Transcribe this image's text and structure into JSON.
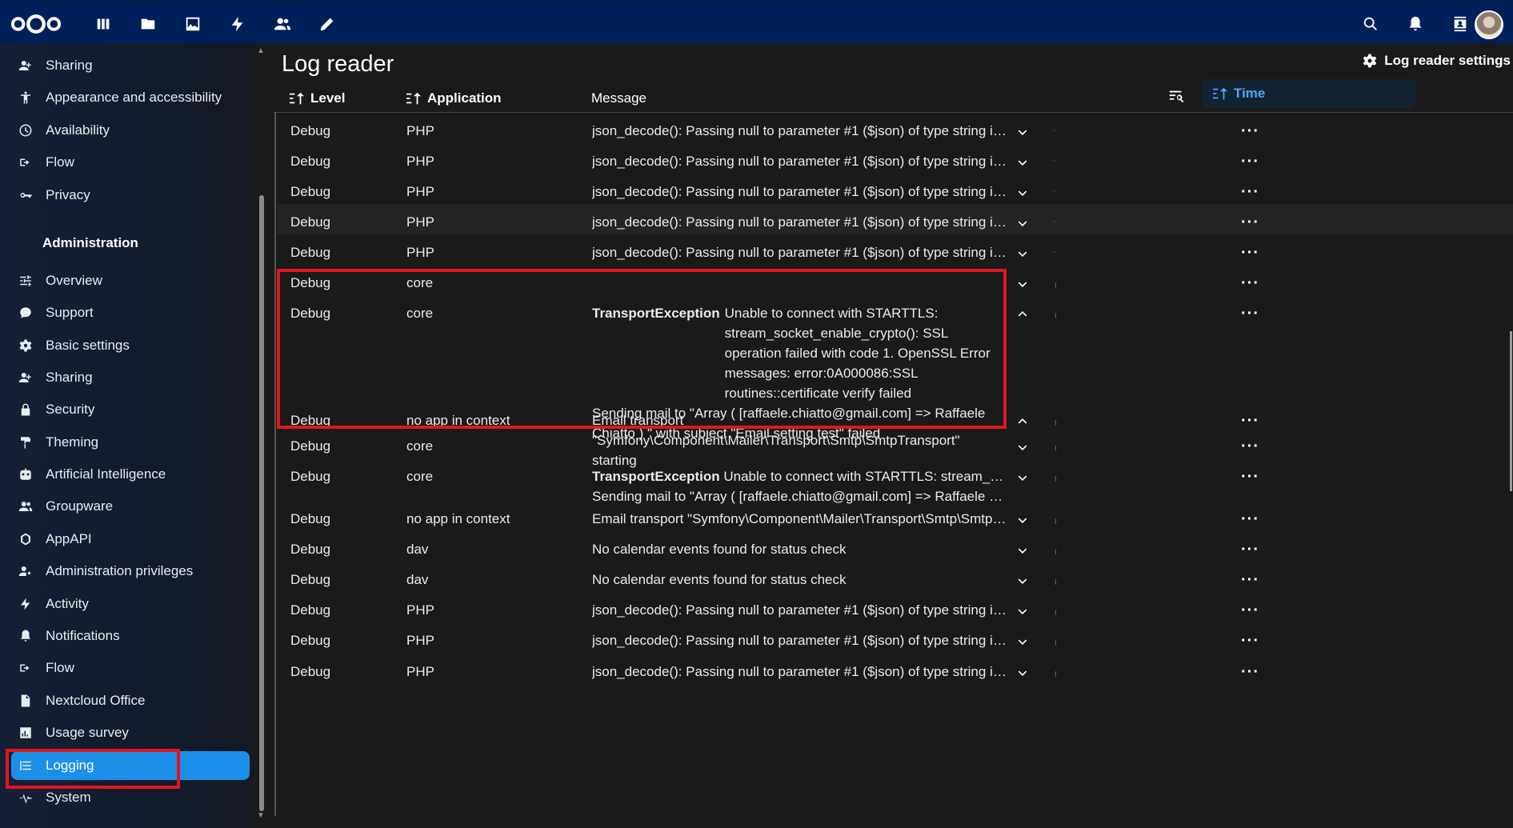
{
  "header": {
    "icons": [
      "nextcloud-logo",
      "dashboard-icon",
      "files-icon",
      "photos-icon",
      "activity-icon",
      "contacts-icon",
      "notes-icon"
    ],
    "right_icons": [
      "search-icon",
      "notifications-icon",
      "contacts-menu-icon",
      "user-avatar"
    ]
  },
  "sidebar": {
    "personal_items": [
      {
        "label": "Sharing",
        "icon": "share-icon"
      },
      {
        "label": "Appearance and accessibility",
        "icon": "accessibility-icon"
      },
      {
        "label": "Availability",
        "icon": "clock-icon"
      },
      {
        "label": "Flow",
        "icon": "flow-icon"
      },
      {
        "label": "Privacy",
        "icon": "key-icon"
      }
    ],
    "admin_heading": "Administration",
    "admin_items": [
      {
        "label": "Overview",
        "icon": "tune-icon"
      },
      {
        "label": "Support",
        "icon": "chat-icon"
      },
      {
        "label": "Basic settings",
        "icon": "gear-icon"
      },
      {
        "label": "Sharing",
        "icon": "share-icon"
      },
      {
        "label": "Security",
        "icon": "lock-icon"
      },
      {
        "label": "Theming",
        "icon": "paint-icon"
      },
      {
        "label": "Artificial Intelligence",
        "icon": "robot-icon"
      },
      {
        "label": "Groupware",
        "icon": "group-icon"
      },
      {
        "label": "AppAPI",
        "icon": "appapi-icon"
      },
      {
        "label": "Administration privileges",
        "icon": "admin-icon"
      },
      {
        "label": "Activity",
        "icon": "activity-icon"
      },
      {
        "label": "Notifications",
        "icon": "bell-icon"
      },
      {
        "label": "Flow",
        "icon": "flow-icon"
      },
      {
        "label": "Nextcloud Office",
        "icon": "document-icon"
      },
      {
        "label": "Usage survey",
        "icon": "chart-icon"
      },
      {
        "label": "Logging",
        "icon": "list-icon",
        "active": true
      },
      {
        "label": "System",
        "icon": "pulse-icon"
      }
    ]
  },
  "main": {
    "title": "Log reader",
    "settings_label": "Log reader settings",
    "columns": {
      "level": "Level",
      "application": "Application",
      "message": "Message",
      "time": "Time"
    },
    "rows": [
      {
        "level": "Debug",
        "app": "PHP",
        "msg": "json_decode(): Passing null to parameter #1 ($json) of type string is deprecated at /..."
      },
      {
        "level": "Debug",
        "app": "PHP",
        "msg": "json_decode(): Passing null to parameter #1 ($json) of type string is deprecated at /..."
      },
      {
        "level": "Debug",
        "app": "PHP",
        "msg": "json_decode(): Passing null to parameter #1 ($json) of type string is deprecated at /..."
      },
      {
        "level": "Debug",
        "app": "PHP",
        "msg": "json_decode(): Passing null to parameter #1 ($json) of type string is deprecated at /..."
      },
      {
        "level": "Debug",
        "app": "PHP",
        "msg": "json_decode(): Passing null to parameter #1 ($json) of type string is deprecated at /..."
      },
      {
        "level": "Debug",
        "app": "core",
        "msg": ""
      },
      {
        "level": "Debug",
        "app": "core",
        "exception": "TransportException",
        "msg": "Unable to connect with STARTTLS: stream_socket_enable_crypto(): SSL operation failed with code 1. OpenSSL Error messages: error:0A000086:SSL routines::certificate verify failed",
        "msg2": "Sending mail to \"Array ( [raffaele.chiatto@gmail.com] => Raffaele Chiatto ) \" with subject \"Email setting test\" failed"
      },
      {
        "level": "Debug",
        "app": "no app in context",
        "msg": "Email transport \"Symfony\\Component\\Mailer\\Transport\\Smtp\\SmtpTransport\" starting"
      },
      {
        "level": "Debug",
        "app": "core",
        "msg": ""
      },
      {
        "level": "Debug",
        "app": "core",
        "exception": "TransportException",
        "msg": "Unable to connect with STARTTLS: stream_socket_enable_cryp...",
        "msg2": "Sending mail to \"Array ( [raffaele.chiatto@gmail.com] => Raffaele Chiatto ) \" with s..."
      },
      {
        "level": "Debug",
        "app": "no app in context",
        "msg": "Email transport \"Symfony\\Component\\Mailer\\Transport\\Smtp\\SmtpTransport\" starti..."
      },
      {
        "level": "Debug",
        "app": "dav",
        "msg": "No calendar events found for status check"
      },
      {
        "level": "Debug",
        "app": "dav",
        "msg": "No calendar events found for status check"
      },
      {
        "level": "Debug",
        "app": "PHP",
        "msg": "json_decode(): Passing null to parameter #1 ($json) of type string is deprecated at /..."
      },
      {
        "level": "Debug",
        "app": "PHP",
        "msg": "json_decode(): Passing null to parameter #1 ($json) of type string is deprecated at /..."
      },
      {
        "level": "Debug",
        "app": "PHP",
        "msg": "json_decode(): Passing null to parameter #1 ($json) of type string is deprecated at /..."
      }
    ]
  }
}
